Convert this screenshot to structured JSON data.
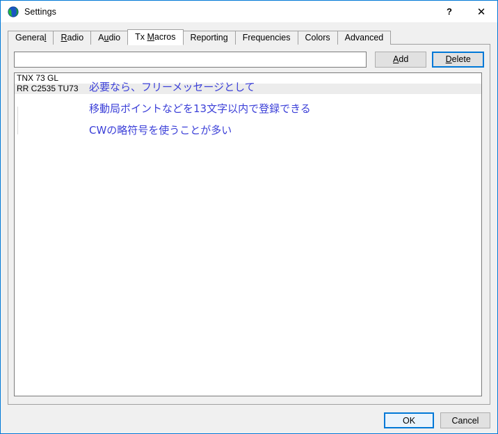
{
  "window": {
    "title": "Settings",
    "icon": "globe-icon",
    "help_label": "?",
    "close_label": "✕",
    "border_color": "#0078d7"
  },
  "tabs": [
    {
      "id": "general",
      "label_before": "Genera",
      "mnemonic": "l",
      "label_after": "",
      "active": false
    },
    {
      "id": "radio",
      "label_before": "",
      "mnemonic": "R",
      "label_after": "adio",
      "active": false
    },
    {
      "id": "audio",
      "label_before": "A",
      "mnemonic": "u",
      "label_after": "dio",
      "active": false
    },
    {
      "id": "tx-macros",
      "label_before": "Tx ",
      "mnemonic": "M",
      "label_after": "acros",
      "active": true
    },
    {
      "id": "reporting",
      "label_before": "Reportin",
      "mnemonic": "g",
      "label_after": "",
      "active": false
    },
    {
      "id": "frequencies",
      "label_before": "Frequencies",
      "mnemonic": "",
      "label_after": "",
      "active": false
    },
    {
      "id": "colors",
      "label_before": "Colors",
      "mnemonic": "",
      "label_after": "",
      "active": false
    },
    {
      "id": "advanced",
      "label_before": "Advanced",
      "mnemonic": "",
      "label_after": "",
      "active": false
    }
  ],
  "macro_editor": {
    "input_value": "",
    "input_placeholder": "",
    "add_button": {
      "label_before": "",
      "mnemonic": "A",
      "label_after": "dd"
    },
    "delete_button": {
      "label_before": "",
      "mnemonic": "D",
      "label_after": "elete"
    }
  },
  "macro_list": {
    "items": [
      {
        "text": "TNX 73 GL",
        "selected": false
      },
      {
        "text": "RR C2535 TU73",
        "selected": true
      }
    ]
  },
  "annotations": {
    "color": "#3c40d8",
    "lines": [
      "必要なら、フリーメッセージとして",
      "移動局ポイントなどを13文字以内で登録できる",
      "CWの略符号を使うことが多い"
    ]
  },
  "footer": {
    "ok_label": "OK",
    "cancel_label": "Cancel"
  }
}
